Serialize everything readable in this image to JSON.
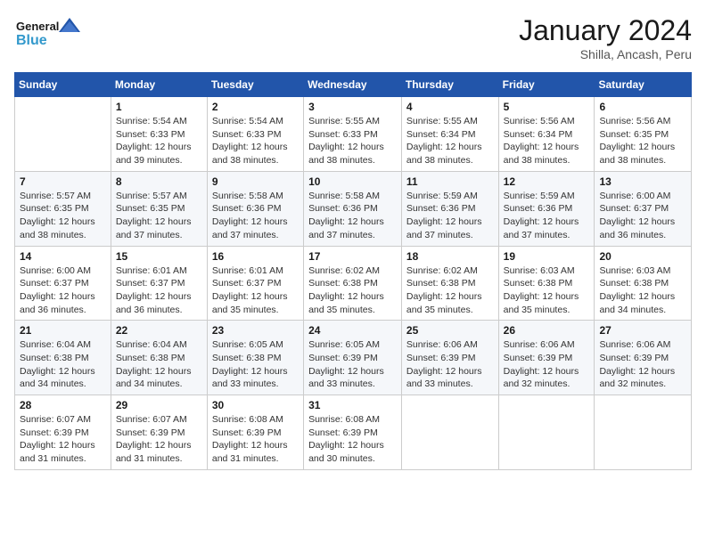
{
  "logo": {
    "general": "General",
    "blue": "Blue"
  },
  "title": "January 2024",
  "subtitle": "Shilla, Ancash, Peru",
  "header_days": [
    "Sunday",
    "Monday",
    "Tuesday",
    "Wednesday",
    "Thursday",
    "Friday",
    "Saturday"
  ],
  "weeks": [
    [
      {
        "day": "",
        "info": ""
      },
      {
        "day": "1",
        "info": "Sunrise: 5:54 AM\nSunset: 6:33 PM\nDaylight: 12 hours\nand 39 minutes."
      },
      {
        "day": "2",
        "info": "Sunrise: 5:54 AM\nSunset: 6:33 PM\nDaylight: 12 hours\nand 38 minutes."
      },
      {
        "day": "3",
        "info": "Sunrise: 5:55 AM\nSunset: 6:33 PM\nDaylight: 12 hours\nand 38 minutes."
      },
      {
        "day": "4",
        "info": "Sunrise: 5:55 AM\nSunset: 6:34 PM\nDaylight: 12 hours\nand 38 minutes."
      },
      {
        "day": "5",
        "info": "Sunrise: 5:56 AM\nSunset: 6:34 PM\nDaylight: 12 hours\nand 38 minutes."
      },
      {
        "day": "6",
        "info": "Sunrise: 5:56 AM\nSunset: 6:35 PM\nDaylight: 12 hours\nand 38 minutes."
      }
    ],
    [
      {
        "day": "7",
        "info": "Sunrise: 5:57 AM\nSunset: 6:35 PM\nDaylight: 12 hours\nand 38 minutes."
      },
      {
        "day": "8",
        "info": "Sunrise: 5:57 AM\nSunset: 6:35 PM\nDaylight: 12 hours\nand 37 minutes."
      },
      {
        "day": "9",
        "info": "Sunrise: 5:58 AM\nSunset: 6:36 PM\nDaylight: 12 hours\nand 37 minutes."
      },
      {
        "day": "10",
        "info": "Sunrise: 5:58 AM\nSunset: 6:36 PM\nDaylight: 12 hours\nand 37 minutes."
      },
      {
        "day": "11",
        "info": "Sunrise: 5:59 AM\nSunset: 6:36 PM\nDaylight: 12 hours\nand 37 minutes."
      },
      {
        "day": "12",
        "info": "Sunrise: 5:59 AM\nSunset: 6:36 PM\nDaylight: 12 hours\nand 37 minutes."
      },
      {
        "day": "13",
        "info": "Sunrise: 6:00 AM\nSunset: 6:37 PM\nDaylight: 12 hours\nand 36 minutes."
      }
    ],
    [
      {
        "day": "14",
        "info": "Sunrise: 6:00 AM\nSunset: 6:37 PM\nDaylight: 12 hours\nand 36 minutes."
      },
      {
        "day": "15",
        "info": "Sunrise: 6:01 AM\nSunset: 6:37 PM\nDaylight: 12 hours\nand 36 minutes."
      },
      {
        "day": "16",
        "info": "Sunrise: 6:01 AM\nSunset: 6:37 PM\nDaylight: 12 hours\nand 35 minutes."
      },
      {
        "day": "17",
        "info": "Sunrise: 6:02 AM\nSunset: 6:38 PM\nDaylight: 12 hours\nand 35 minutes."
      },
      {
        "day": "18",
        "info": "Sunrise: 6:02 AM\nSunset: 6:38 PM\nDaylight: 12 hours\nand 35 minutes."
      },
      {
        "day": "19",
        "info": "Sunrise: 6:03 AM\nSunset: 6:38 PM\nDaylight: 12 hours\nand 35 minutes."
      },
      {
        "day": "20",
        "info": "Sunrise: 6:03 AM\nSunset: 6:38 PM\nDaylight: 12 hours\nand 34 minutes."
      }
    ],
    [
      {
        "day": "21",
        "info": "Sunrise: 6:04 AM\nSunset: 6:38 PM\nDaylight: 12 hours\nand 34 minutes."
      },
      {
        "day": "22",
        "info": "Sunrise: 6:04 AM\nSunset: 6:38 PM\nDaylight: 12 hours\nand 34 minutes."
      },
      {
        "day": "23",
        "info": "Sunrise: 6:05 AM\nSunset: 6:38 PM\nDaylight: 12 hours\nand 33 minutes."
      },
      {
        "day": "24",
        "info": "Sunrise: 6:05 AM\nSunset: 6:39 PM\nDaylight: 12 hours\nand 33 minutes."
      },
      {
        "day": "25",
        "info": "Sunrise: 6:06 AM\nSunset: 6:39 PM\nDaylight: 12 hours\nand 33 minutes."
      },
      {
        "day": "26",
        "info": "Sunrise: 6:06 AM\nSunset: 6:39 PM\nDaylight: 12 hours\nand 32 minutes."
      },
      {
        "day": "27",
        "info": "Sunrise: 6:06 AM\nSunset: 6:39 PM\nDaylight: 12 hours\nand 32 minutes."
      }
    ],
    [
      {
        "day": "28",
        "info": "Sunrise: 6:07 AM\nSunset: 6:39 PM\nDaylight: 12 hours\nand 31 minutes."
      },
      {
        "day": "29",
        "info": "Sunrise: 6:07 AM\nSunset: 6:39 PM\nDaylight: 12 hours\nand 31 minutes."
      },
      {
        "day": "30",
        "info": "Sunrise: 6:08 AM\nSunset: 6:39 PM\nDaylight: 12 hours\nand 31 minutes."
      },
      {
        "day": "31",
        "info": "Sunrise: 6:08 AM\nSunset: 6:39 PM\nDaylight: 12 hours\nand 30 minutes."
      },
      {
        "day": "",
        "info": ""
      },
      {
        "day": "",
        "info": ""
      },
      {
        "day": "",
        "info": ""
      }
    ]
  ]
}
